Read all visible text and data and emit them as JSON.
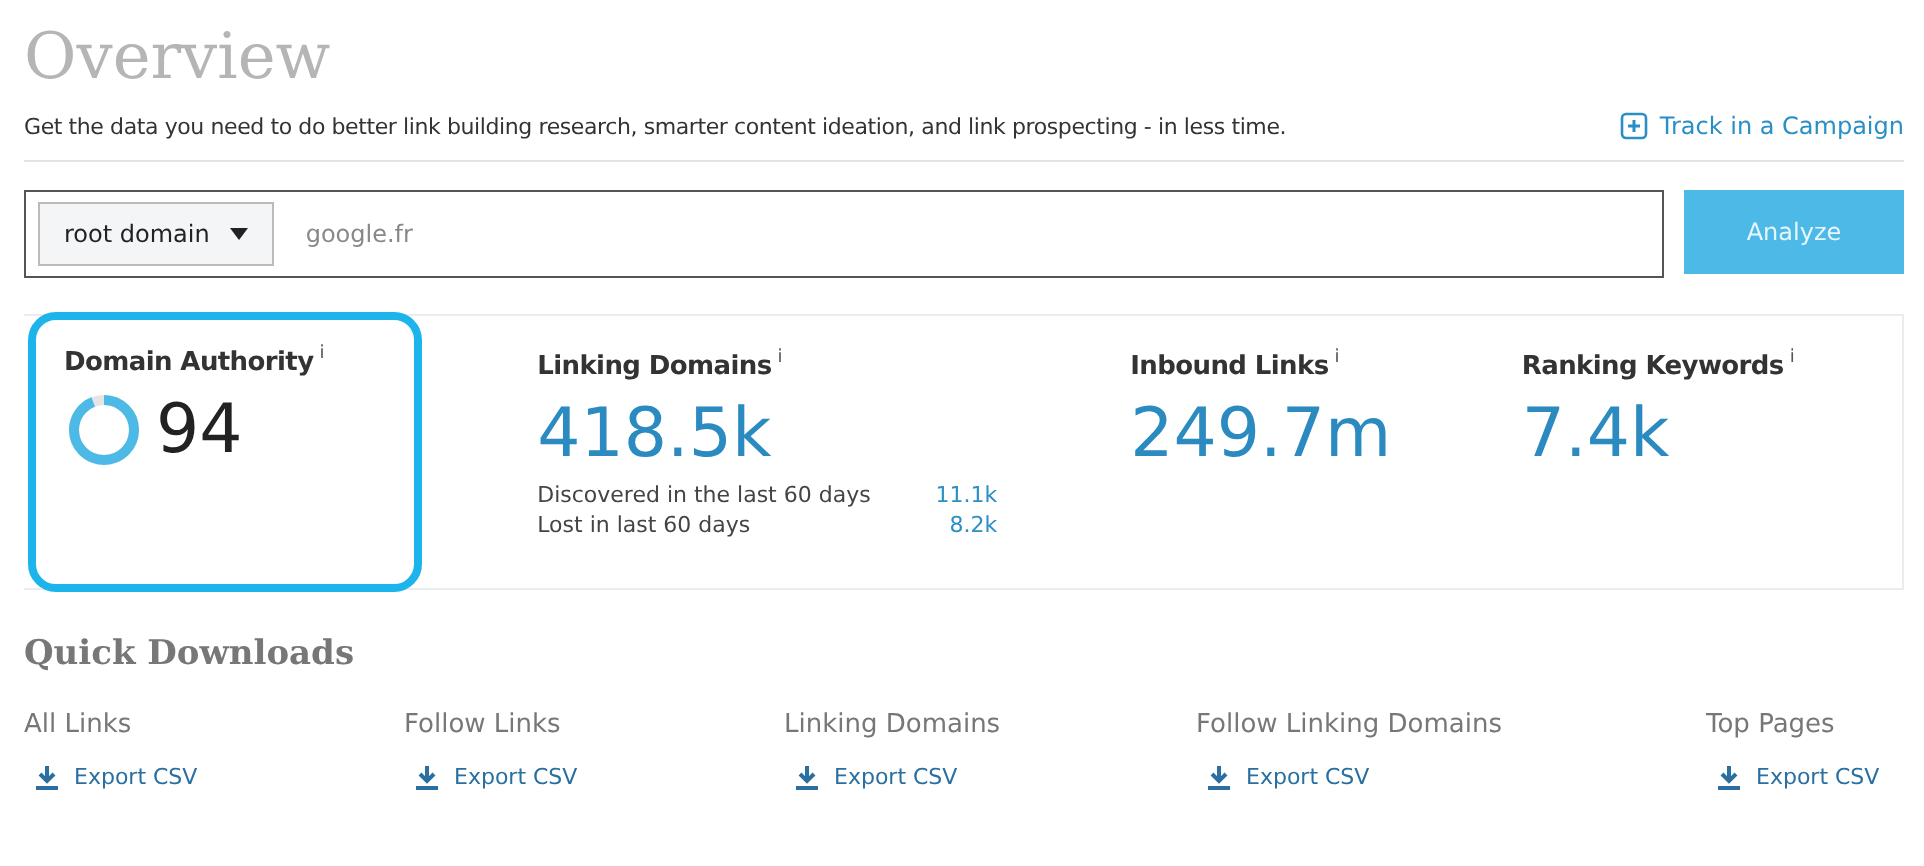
{
  "header": {
    "title": "Overview",
    "subtitle": "Get the data you need to do better link building research, smarter content ideation, and link prospecting - in less time.",
    "track_link": "Track in a Campaign"
  },
  "search": {
    "scope": "root domain",
    "value": "google.fr",
    "button": "Analyze"
  },
  "metrics": [
    {
      "kind": "ring",
      "label": "Domain Authority",
      "info": "i",
      "value": "94",
      "highlighted": true
    },
    {
      "kind": "number",
      "label": "Linking Domains",
      "info": "i",
      "value": "418.5k",
      "details": [
        {
          "label": "Discovered in the last 60 days",
          "value": "11.1k"
        },
        {
          "label": "Lost in last 60 days",
          "value": "8.2k"
        }
      ]
    },
    {
      "kind": "number",
      "label": "Inbound Links",
      "info": "i",
      "value": "249.7m"
    },
    {
      "kind": "number",
      "label": "Ranking Keywords",
      "info": "i",
      "value": "7.4k"
    }
  ],
  "downloads": {
    "title": "Quick Downloads",
    "items": [
      {
        "label": "All Links",
        "action": "Export CSV"
      },
      {
        "label": "Follow Links",
        "action": "Export CSV"
      },
      {
        "label": "Linking Domains",
        "action": "Export CSV"
      },
      {
        "label": "Follow Linking Domains",
        "action": "Export CSV"
      },
      {
        "label": "Top Pages",
        "action": "Export CSV"
      }
    ]
  }
}
